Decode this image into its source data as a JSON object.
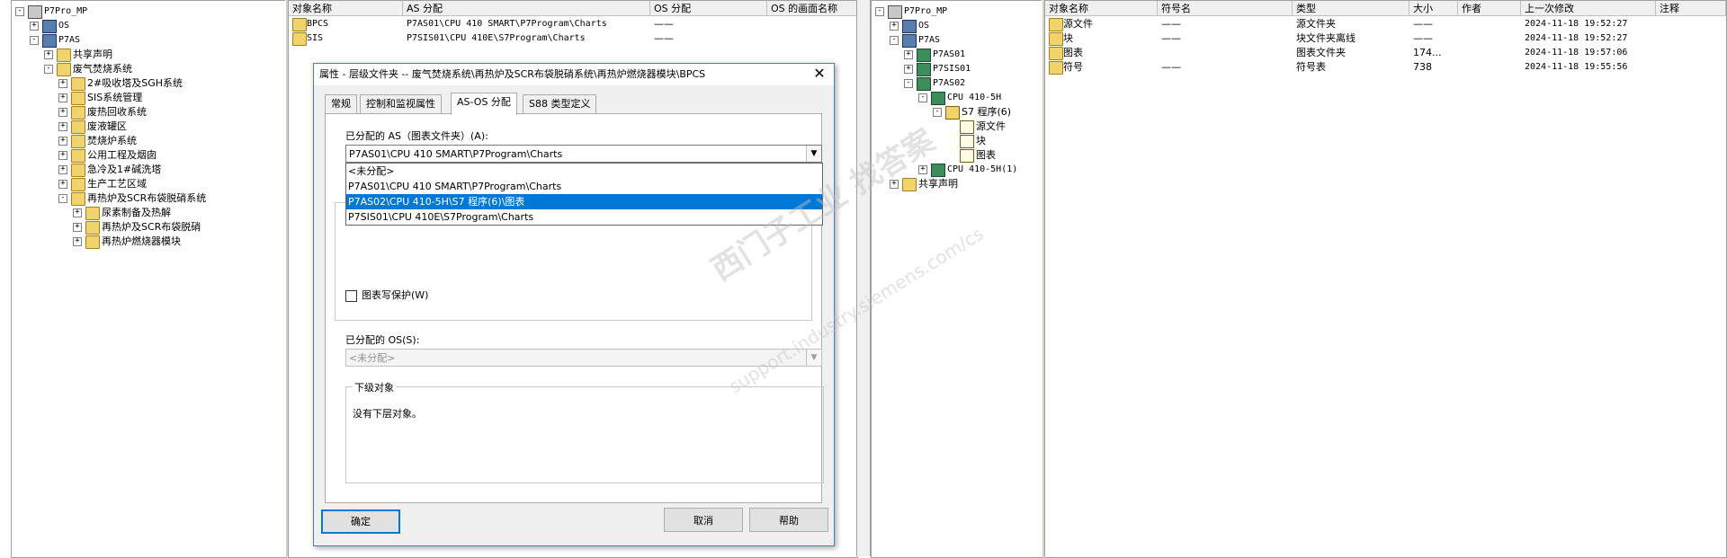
{
  "left_tree": [
    {
      "label": "P7Pro_MP",
      "indent": 0,
      "exp": "-",
      "icon": "proj",
      "mono": true
    },
    {
      "label": "OS",
      "indent": 1,
      "exp": "+",
      "icon": "station",
      "mono": true
    },
    {
      "label": "P7AS",
      "indent": 1,
      "exp": "-",
      "icon": "station",
      "mono": true
    },
    {
      "label": "共享声明",
      "indent": 2,
      "exp": "+",
      "icon": "folder",
      "mono": false
    },
    {
      "label": "废气焚烧系统",
      "indent": 2,
      "exp": "-",
      "icon": "folder",
      "mono": false
    },
    {
      "label": "2#吸收塔及SGH系统",
      "indent": 3,
      "exp": "+",
      "icon": "folder",
      "mono": false
    },
    {
      "label": "SIS系统管理",
      "indent": 3,
      "exp": "+",
      "icon": "folder",
      "mono": false
    },
    {
      "label": "废热回收系统",
      "indent": 3,
      "exp": "+",
      "icon": "folder",
      "mono": false
    },
    {
      "label": "废液罐区",
      "indent": 3,
      "exp": "+",
      "icon": "folder",
      "mono": false
    },
    {
      "label": "焚烧炉系统",
      "indent": 3,
      "exp": "+",
      "icon": "folder",
      "mono": false
    },
    {
      "label": "公用工程及烟囱",
      "indent": 3,
      "exp": "+",
      "icon": "folder",
      "mono": false
    },
    {
      "label": "急冷及1#碱洗塔",
      "indent": 3,
      "exp": "+",
      "icon": "folder",
      "mono": false
    },
    {
      "label": "生产工艺区域",
      "indent": 3,
      "exp": "+",
      "icon": "folder",
      "mono": false
    },
    {
      "label": "再热炉及SCR布袋脱硝系统",
      "indent": 3,
      "exp": "-",
      "icon": "folder",
      "mono": false
    },
    {
      "label": "尿素制备及热解",
      "indent": 4,
      "exp": "+",
      "icon": "folder",
      "mono": false
    },
    {
      "label": "再热炉及SCR布袋脱硝",
      "indent": 4,
      "exp": "+",
      "icon": "folder",
      "mono": false
    },
    {
      "label": "再热炉燃烧器模块",
      "indent": 4,
      "exp": "+",
      "icon": "folder",
      "mono": false
    }
  ],
  "left_list": {
    "headers": [
      "对象名称",
      "AS 分配",
      "OS 分配",
      "OS 的画面名称"
    ],
    "rows": [
      [
        "BPCS",
        "P7AS01\\CPU 410 SMART\\P7Program\\Charts",
        "——",
        ""
      ],
      [
        "SIS",
        "P7SIS01\\CPU 410E\\S7Program\\Charts",
        "——",
        ""
      ]
    ]
  },
  "dialog": {
    "title": "属性 - 层级文件夹 -- 废气焚烧系统\\再热炉及SCR布袋脱硝系统\\再热炉燃烧器模块\\BPCS",
    "close": "✕",
    "tabs": [
      "常规",
      "控制和监视属性",
      "AS-OS 分配",
      "S88 类型定义"
    ],
    "active_tab": 2,
    "as_label": "已分配的 AS（图表文件夹）(A):",
    "as_value": "P7AS01\\CPU 410 SMART\\P7Program\\Charts",
    "as_options": [
      "<未分配>",
      "P7AS01\\CPU 410 SMART\\P7Program\\Charts",
      "P7AS02\\CPU 410-5H\\S7 程序(6)\\图表",
      "P7SIS01\\CPU 410E\\S7Program\\Charts"
    ],
    "as_selected_index": 2,
    "write_protect_label": "图表写保护(W)",
    "os_label": "已分配的 OS(S):",
    "os_value": "<未分配>",
    "sub_group_label": "下级对象",
    "sub_text": "没有下层对象。",
    "ok": "确定",
    "cancel": "取消",
    "help": "帮助"
  },
  "right_tree": [
    {
      "label": "P7Pro_MP",
      "indent": 0,
      "exp": "-",
      "icon": "proj",
      "mono": true
    },
    {
      "label": "OS",
      "indent": 1,
      "exp": "+",
      "icon": "station",
      "mono": true
    },
    {
      "label": "P7AS",
      "indent": 1,
      "exp": "-",
      "icon": "station",
      "mono": true
    },
    {
      "label": "P7AS01",
      "indent": 2,
      "exp": "+",
      "icon": "cpu",
      "mono": true
    },
    {
      "label": "P7SIS01",
      "indent": 2,
      "exp": "+",
      "icon": "cpu",
      "mono": true
    },
    {
      "label": "P7AS02",
      "indent": 2,
      "exp": "-",
      "icon": "cpu",
      "mono": true
    },
    {
      "label": "CPU 410-5H",
      "indent": 3,
      "exp": "-",
      "icon": "cpu",
      "mono": true
    },
    {
      "label": "S7 程序(6)",
      "indent": 4,
      "exp": "-",
      "icon": "prog",
      "mono": false
    },
    {
      "label": "源文件",
      "indent": 5,
      "exp": "",
      "icon": "doc",
      "mono": false
    },
    {
      "label": "块",
      "indent": 5,
      "exp": "",
      "icon": "doc",
      "mono": false
    },
    {
      "label": "图表",
      "indent": 5,
      "exp": "",
      "icon": "doc",
      "mono": false
    },
    {
      "label": "CPU 410-5H(1)",
      "indent": 3,
      "exp": "+",
      "icon": "cpu",
      "mono": true
    },
    {
      "label": "共享声明",
      "indent": 1,
      "exp": "+",
      "icon": "folder",
      "mono": false
    }
  ],
  "right_list": {
    "headers": [
      "对象名称",
      "符号名",
      "类型",
      "大小",
      "作者",
      "上一次修改",
      "注释"
    ],
    "rows": [
      [
        "源文件",
        "——",
        "源文件夹",
        "——",
        "",
        "2024-11-18  19:52:27",
        ""
      ],
      [
        "块",
        "——",
        "块文件夹离线",
        "——",
        "",
        "2024-11-18  19:52:27",
        ""
      ],
      [
        "图表",
        "",
        "图表文件夹",
        "174...",
        "",
        "2024-11-18  19:57:06",
        ""
      ],
      [
        "符号",
        "——",
        "符号表",
        "738",
        "",
        "2024-11-18  19:55:56",
        ""
      ]
    ]
  },
  "watermark": {
    "line1": "西门子工业  找答案",
    "line2": "support.industry.siemens.com/cs"
  }
}
